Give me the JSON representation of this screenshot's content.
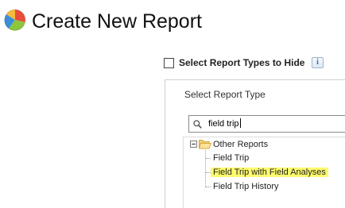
{
  "header": {
    "title": "Create New Report",
    "icon": "report-icon"
  },
  "options": {
    "hide_types_label": "Select Report Types to Hide",
    "hide_types_checked": false,
    "info_icon": "info-icon",
    "info_glyph": "i"
  },
  "report_type_panel": {
    "label": "Select Report Type",
    "search": {
      "value": "field trip",
      "icon": "search-icon"
    },
    "tree": {
      "folder": {
        "label": "Other Reports",
        "expanded": true,
        "icon": "folder-open-icon"
      },
      "items": [
        {
          "label": "Field Trip",
          "selected": false
        },
        {
          "label": "Field Trip with Field Analyses",
          "selected": true
        },
        {
          "label": "Field Trip History",
          "selected": false
        }
      ]
    }
  },
  "colors": {
    "selected_highlight": "#fdfa6e",
    "info_icon_text": "#3a6ea5"
  }
}
